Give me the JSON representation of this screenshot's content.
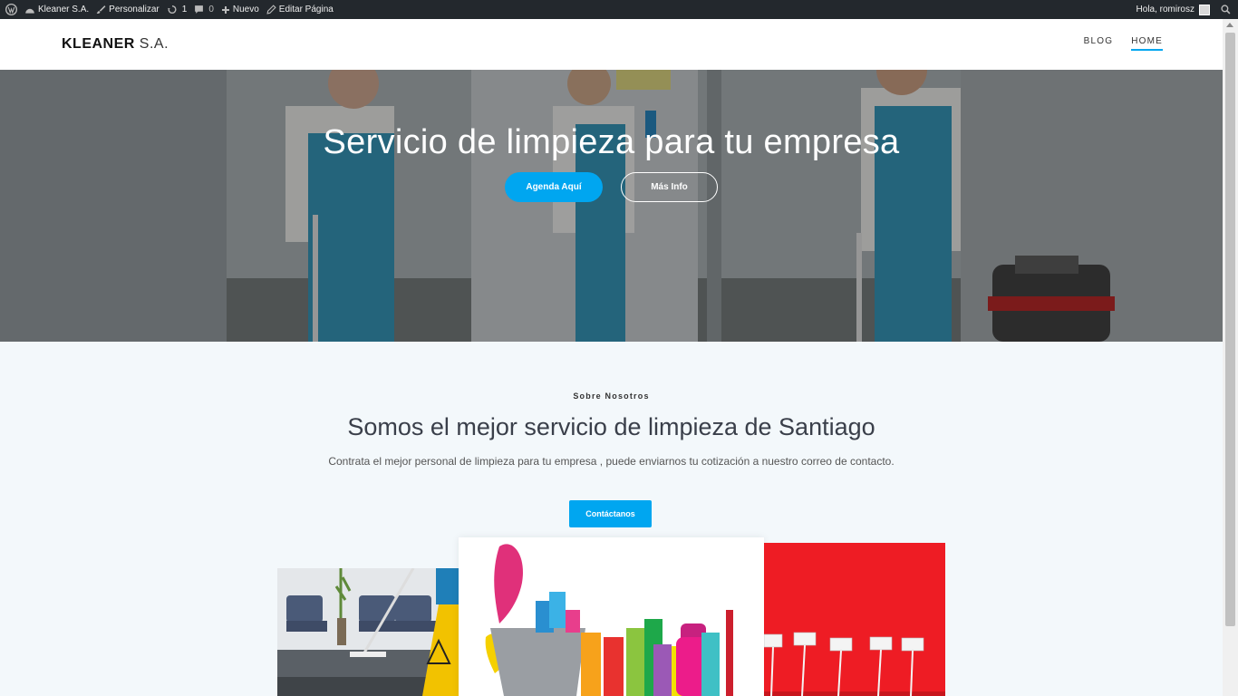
{
  "admin_bar": {
    "site_name": "Kleaner S.A.",
    "customize": "Personalizar",
    "revisions_count": "1",
    "comments_count": "0",
    "new_label": "Nuevo",
    "edit_page": "Editar Página",
    "greeting": "Hola, romirosz"
  },
  "header": {
    "logo_bold": "KLEANER",
    "logo_light": "S.A.",
    "nav": [
      {
        "label": "BLOG"
      },
      {
        "label": "HOME"
      }
    ]
  },
  "hero": {
    "title": "Servicio de limpieza para tu empresa",
    "primary_button": "Agenda Aquí",
    "secondary_button": "Más Info"
  },
  "about": {
    "kicker": "Sobre Nosotros",
    "title": "Somos el mejor servicio de limpieza de Santiago",
    "text": "Contrata el mejor personal de limpieza para tu empresa , puede enviarnos tu cotización a nuestro correo de contacto.",
    "button": "Contáctanos"
  },
  "colors": {
    "accent": "#00a6f0",
    "admin_bar": "#23282d",
    "section_bg": "#f3f8fb"
  }
}
